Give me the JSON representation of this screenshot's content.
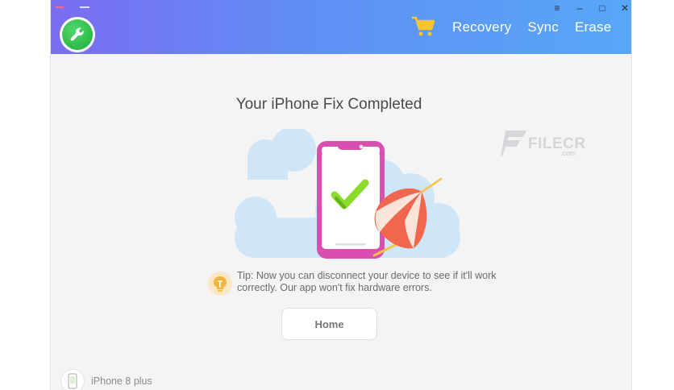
{
  "header": {
    "nav": [
      "Recovery",
      "Sync",
      "Erase"
    ],
    "window_controls": {
      "menu": "≡",
      "minimize": "–",
      "maximize": "□",
      "close": "✕"
    }
  },
  "icons": {
    "logo": "wrench-icon",
    "cart": "cart-icon",
    "tip": "lightbulb-icon",
    "device": "iphone-icon"
  },
  "main": {
    "title": "Your iPhone Fix Completed",
    "tip_text": "Tip: Now you can disconnect your device to see if it'll work correctly. Our app won't fix hardware errors.",
    "home_button": "Home"
  },
  "watermark": {
    "name": "FILECR",
    "domain": ".com"
  },
  "footer": {
    "device_name": "iPhone 8 plus"
  },
  "colors": {
    "header_start": "#7b6cf2",
    "header_end": "#58a7f7",
    "cart": "#f7c631",
    "phone": "#d94fb0",
    "check": "#8bdc2a",
    "logo_green": "#1fae3c"
  }
}
